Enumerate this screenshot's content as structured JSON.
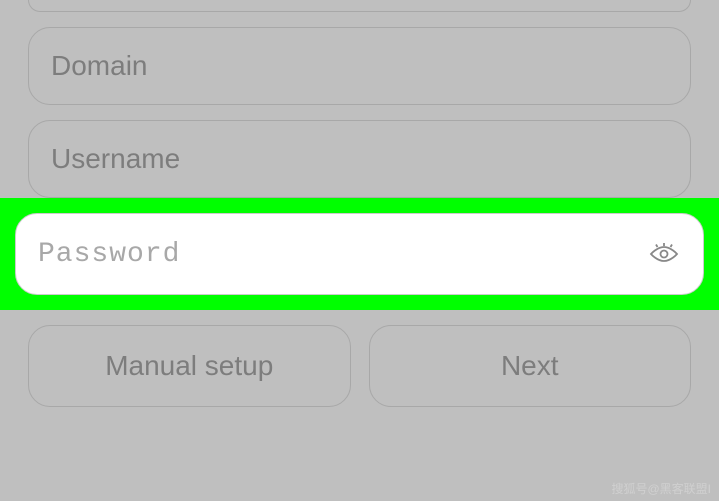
{
  "fields": {
    "domain": {
      "placeholder": "Domain",
      "value": ""
    },
    "username": {
      "placeholder": "Username",
      "value": ""
    },
    "password": {
      "placeholder": "Password",
      "value": ""
    }
  },
  "buttons": {
    "manual_setup": "Manual setup",
    "next": "Next"
  },
  "watermark": "搜狐号@黑客联盟I"
}
